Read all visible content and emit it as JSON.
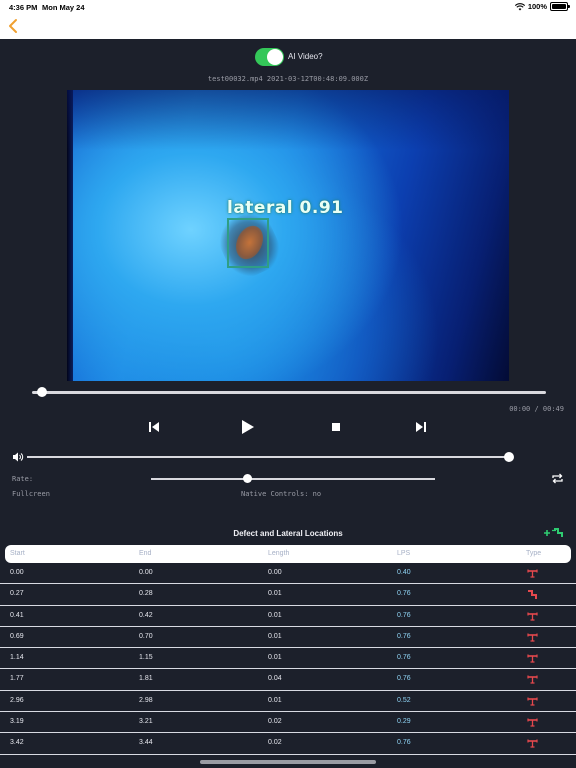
{
  "status": {
    "time": "4:36 PM",
    "date": "Mon May 24",
    "battery": "100%",
    "battery_level": 1.0
  },
  "toggle": {
    "label": "AI Video?",
    "on": true,
    "color": "#34c759"
  },
  "video": {
    "filename": "test00032.mp4 2021-03-12T00:48:09.000Z",
    "detection_label": "lateral 0.91",
    "box_color": "#2f9e86"
  },
  "player": {
    "timecode": "00:00 / 00:49",
    "seek_progress": 0.02,
    "volume_level": 1.0,
    "rate_label": "Rate:",
    "fullscreen_label": "Fullcreen",
    "native_controls_label": "Native Controls: no",
    "icons": [
      "skip-back-icon",
      "play-icon",
      "stop-icon",
      "skip-forward-icon",
      "speaker-icon",
      "repeat-icon"
    ]
  },
  "table": {
    "title": "Defect and Lateral Locations",
    "headers": {
      "start": "Start",
      "end": "End",
      "length": "Length",
      "lps": "LPS",
      "type": "Type"
    },
    "type_colors": {
      "defect": "#e5484d",
      "lateral": "#e5484d"
    },
    "rows": [
      {
        "start": "0.00",
        "end": "0.00",
        "length": "0.00",
        "lps": "0.40",
        "type": "defect"
      },
      {
        "start": "0.27",
        "end": "0.28",
        "length": "0.01",
        "lps": "0.76",
        "type": "lateral"
      },
      {
        "start": "0.41",
        "end": "0.42",
        "length": "0.01",
        "lps": "0.76",
        "type": "defect"
      },
      {
        "start": "0.69",
        "end": "0.70",
        "length": "0.01",
        "lps": "0.76",
        "type": "defect"
      },
      {
        "start": "1.14",
        "end": "1.15",
        "length": "0.01",
        "lps": "0.76",
        "type": "defect"
      },
      {
        "start": "1.77",
        "end": "1.81",
        "length": "0.04",
        "lps": "0.76",
        "type": "defect"
      },
      {
        "start": "2.96",
        "end": "2.98",
        "length": "0.01",
        "lps": "0.52",
        "type": "defect"
      },
      {
        "start": "3.19",
        "end": "3.21",
        "length": "0.02",
        "lps": "0.29",
        "type": "defect"
      },
      {
        "start": "3.42",
        "end": "3.44",
        "length": "0.02",
        "lps": "0.76",
        "type": "defect"
      }
    ]
  }
}
